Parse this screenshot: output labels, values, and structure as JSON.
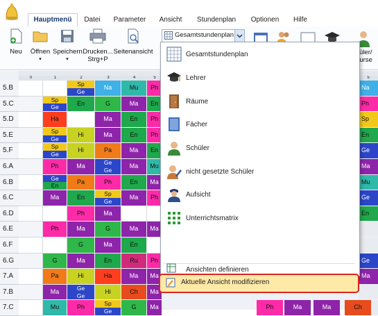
{
  "tabs": [
    "Hauptmenü",
    "Datei",
    "Parameter",
    "Ansicht",
    "Stundenplan",
    "Optionen",
    "Hilfe"
  ],
  "ribbon": {
    "neu": "Neu",
    "oeffnen": "Öffnen",
    "speichern": "Speichern",
    "drucken": "Drucken...",
    "drucken_shortcut": "Strg+P",
    "seitenansicht": "Seitenansicht",
    "combo_value": "Gesamtstundenplan",
    "schueler_kurse_1": "chüler/",
    "schueler_kurse_2": "Kurse"
  },
  "grid": {
    "day": "Montag",
    "col_headers": [
      "0",
      "1",
      "2",
      "3",
      "4",
      "5"
    ],
    "right_col_header": "5",
    "rows": [
      {
        "label": "5.B",
        "cells": [
          [
            "",
            ""
          ],
          [
            "",
            ""
          ],
          [
            "Sp",
            "Ge"
          ],
          [
            "Na",
            ""
          ],
          [
            "Mu",
            ""
          ],
          [
            "Ph",
            ""
          ]
        ]
      },
      {
        "label": "5.C",
        "cells": [
          [
            "",
            ""
          ],
          [
            "Sp",
            "Ge"
          ],
          [
            "En",
            ""
          ],
          [
            "G",
            ""
          ],
          [
            "Ma",
            ""
          ],
          [
            "En",
            ""
          ]
        ]
      },
      {
        "label": "5.D",
        "cells": [
          [
            "",
            ""
          ],
          [
            "Ha",
            ""
          ],
          [
            "",
            ""
          ],
          [
            "Ma",
            ""
          ],
          [
            "En",
            ""
          ],
          [
            "Ph",
            ""
          ]
        ]
      },
      {
        "label": "5.E",
        "cells": [
          [
            "",
            ""
          ],
          [
            "Sp",
            "Ge"
          ],
          [
            "Hi",
            ""
          ],
          [
            "Ma",
            ""
          ],
          [
            "En",
            ""
          ],
          [
            "Ph",
            ""
          ]
        ]
      },
      {
        "label": "5.F",
        "cells": [
          [
            "",
            ""
          ],
          [
            "Sp",
            "Ge"
          ],
          [
            "Hi",
            ""
          ],
          [
            "Pa",
            ""
          ],
          [
            "Ma",
            ""
          ],
          [
            "En",
            ""
          ]
        ]
      },
      {
        "label": "6.A",
        "cells": [
          [
            "",
            ""
          ],
          [
            "Ph",
            ""
          ],
          [
            "Ma",
            ""
          ],
          [
            "Ge",
            "Ge"
          ],
          [
            "Ma",
            ""
          ],
          [
            "Mu",
            ""
          ]
        ]
      },
      {
        "label": "6.B",
        "cells": [
          [
            "",
            ""
          ],
          [
            "Ge",
            "En"
          ],
          [
            "Pa",
            ""
          ],
          [
            "Ph",
            ""
          ],
          [
            "En",
            ""
          ],
          [
            "Ma",
            ""
          ]
        ]
      },
      {
        "label": "6.C",
        "cells": [
          [
            "",
            ""
          ],
          [
            "Ma",
            ""
          ],
          [
            "En",
            ""
          ],
          [
            "Sp",
            "Ge"
          ],
          [
            "Ma",
            ""
          ],
          [
            "Ph",
            ""
          ]
        ]
      },
      {
        "label": "6.D",
        "cells": [
          [
            "",
            ""
          ],
          [
            "",
            ""
          ],
          [
            "Ph",
            ""
          ],
          [
            "Ma",
            ""
          ],
          [
            "",
            ""
          ],
          [
            "",
            ""
          ]
        ]
      },
      {
        "label": "6.E",
        "cells": [
          [
            "",
            ""
          ],
          [
            "Ph",
            ""
          ],
          [
            "Ma",
            ""
          ],
          [
            "G",
            ""
          ],
          [
            "Ma",
            ""
          ],
          [
            "Ma",
            ""
          ]
        ]
      },
      {
        "label": "6.F",
        "cells": [
          [
            "",
            ""
          ],
          [
            "",
            ""
          ],
          [
            "G",
            ""
          ],
          [
            "Ma",
            ""
          ],
          [
            "En",
            ""
          ],
          [
            "",
            ""
          ]
        ]
      },
      {
        "label": "6.G",
        "cells": [
          [
            "",
            ""
          ],
          [
            "G",
            ""
          ],
          [
            "Ma",
            ""
          ],
          [
            "En",
            ""
          ],
          [
            "Ru",
            ""
          ],
          [
            "Ph",
            ""
          ]
        ]
      },
      {
        "label": "7.A",
        "cells": [
          [
            "",
            ""
          ],
          [
            "Pa",
            ""
          ],
          [
            "Hi",
            ""
          ],
          [
            "Ha",
            ""
          ],
          [
            "Ma",
            ""
          ],
          [
            "Ma",
            ""
          ]
        ]
      },
      {
        "label": "7.B",
        "cells": [
          [
            "",
            ""
          ],
          [
            "Ma",
            ""
          ],
          [
            "Ge",
            "Ge"
          ],
          [
            "Hi",
            ""
          ],
          [
            "Ch",
            ""
          ],
          [
            "Ma",
            ""
          ]
        ]
      },
      {
        "label": "7.C",
        "cells": [
          [
            "",
            ""
          ],
          [
            "Mu",
            ""
          ],
          [
            "Ph",
            ""
          ],
          [
            "Sp",
            "Ge"
          ],
          [
            "G",
            ""
          ],
          [
            "Ma",
            ""
          ]
        ]
      }
    ],
    "right_col": [
      "Na",
      "Ph",
      "Sp",
      "En",
      "Ge",
      "Ma",
      "Mu",
      "Ge",
      "En",
      "",
      "",
      "Ge",
      "Ma",
      "",
      ""
    ]
  },
  "menu": {
    "items": [
      {
        "label": "Gesamtstundenplan",
        "icon": "grid-icon"
      },
      {
        "label": "Lehrer",
        "icon": "teacher-icon"
      },
      {
        "label": "Räume",
        "icon": "door-icon"
      },
      {
        "label": "Fächer",
        "icon": "book-icon"
      },
      {
        "label": "Schüler",
        "icon": "student-icon"
      },
      {
        "label": "nicht gesetzte Schüler",
        "icon": "student-pencil-icon"
      },
      {
        "label": "Aufsicht",
        "icon": "supervisor-icon"
      },
      {
        "label": "Unterrichtsmatrix",
        "icon": "matrix-icon"
      }
    ],
    "define_views": "Ansichten definieren",
    "modify_view": "Aktuelle Ansicht modifizieren"
  },
  "bottom_partial": [
    "Ph",
    "Ma",
    "Ma",
    "Ch"
  ],
  "colors": {
    "accent": "#d8261b",
    "highlight": "#ffe9a8",
    "ribbon_bg": "#fbfcfe"
  }
}
